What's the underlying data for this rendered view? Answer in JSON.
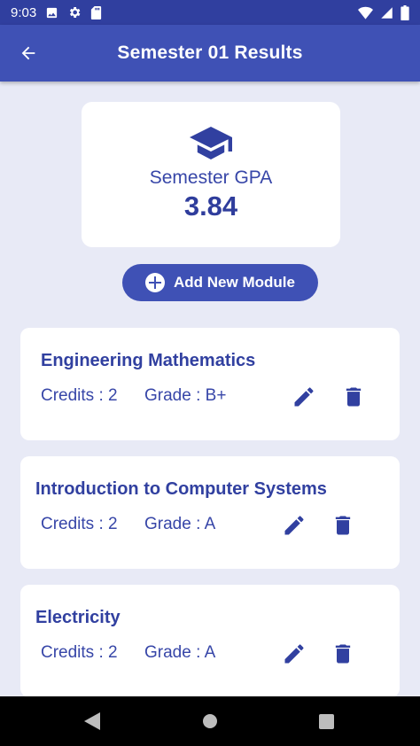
{
  "status_bar": {
    "time": "9:03",
    "left_icons": [
      "image-icon",
      "gear-icon",
      "sd-card-icon"
    ],
    "right_icons": [
      "wifi-icon",
      "cellular-signal-icon",
      "battery-icon"
    ]
  },
  "app_bar": {
    "title": "Semester 01 Results",
    "back_icon": "arrow-back-icon"
  },
  "gpa_card": {
    "icon": "graduation-cap-icon",
    "label": "Semester GPA",
    "value": "3.84"
  },
  "add_button": {
    "label": "Add New Module",
    "icon": "add-circle-icon"
  },
  "modules": [
    {
      "name": "Engineering Mathematics",
      "credits": "Credits : 2",
      "grade": "Grade : B+"
    },
    {
      "name": "Introduction to Computer Systems",
      "credits": "Credits : 2",
      "grade": "Grade : A"
    },
    {
      "name": "Electricity",
      "credits": "Credits : 2",
      "grade": "Grade : A"
    }
  ],
  "nav_bar": {
    "icons": [
      "back-triangle-icon",
      "home-circle-icon",
      "recents-square-icon"
    ]
  },
  "colors": {
    "primary": "#3f51b5",
    "primary_dark": "#303f9f",
    "text_accent": "#3140a0",
    "background": "#e8eaf6"
  }
}
